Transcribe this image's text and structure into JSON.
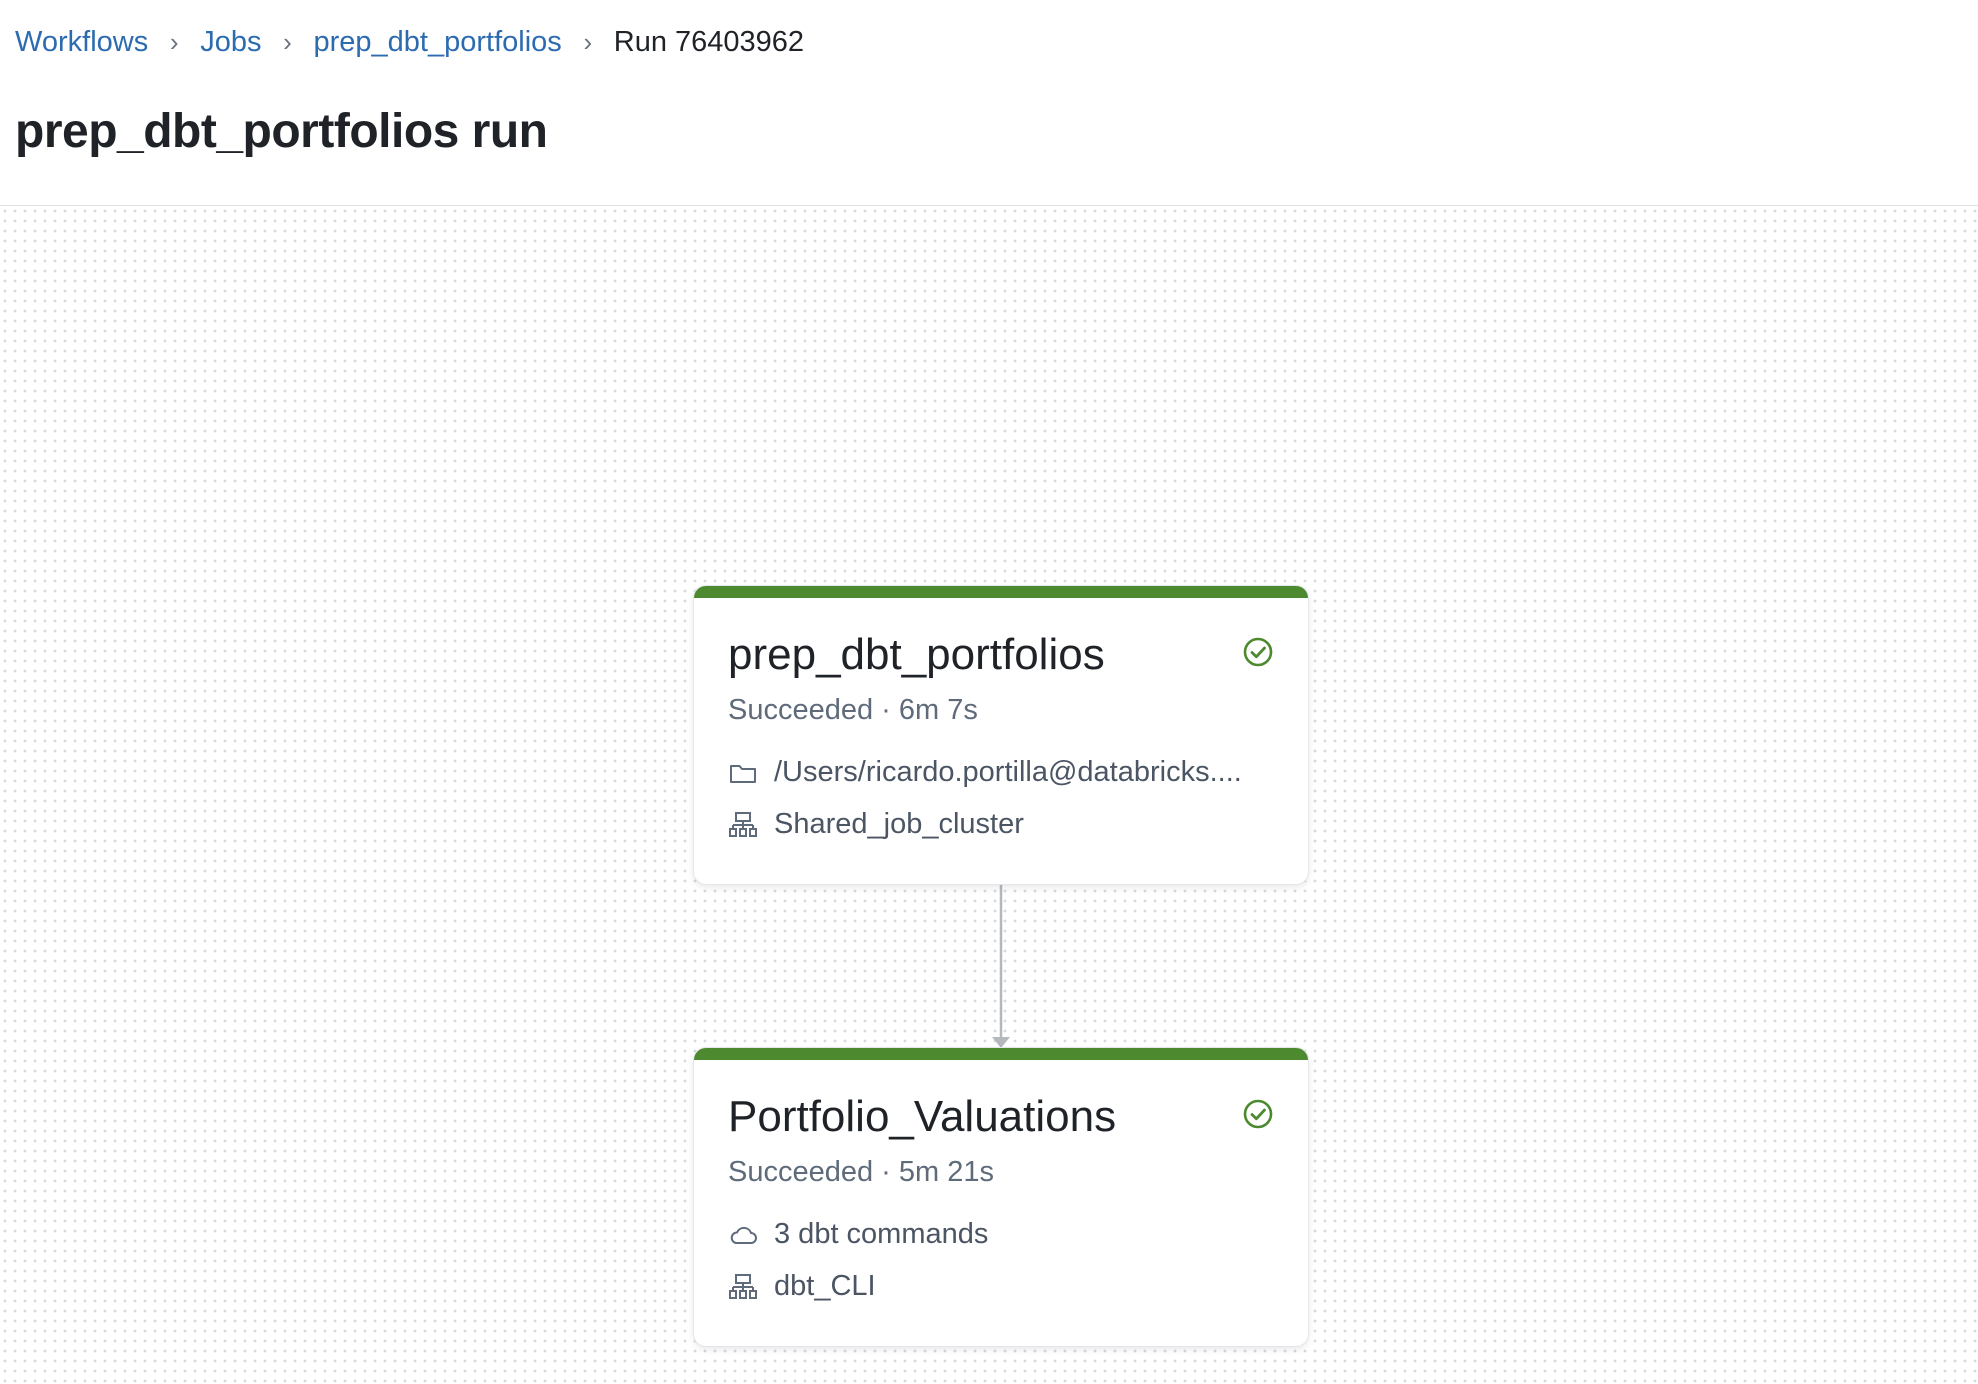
{
  "breadcrumb": {
    "items": [
      "Workflows",
      "Jobs",
      "prep_dbt_portfolios"
    ],
    "current": "Run 76403962"
  },
  "page": {
    "title": "prep_dbt_portfolios run"
  },
  "colors": {
    "success": "#4d8a2f",
    "link": "#2d6bb1"
  },
  "tasks": [
    {
      "name": "prep_dbt_portfolios",
      "status": "Succeeded · 6m 7s",
      "source_icon": "folder-icon",
      "source": "/Users/ricardo.portilla@databricks....",
      "cluster_icon": "cluster-icon",
      "cluster": "Shared_job_cluster"
    },
    {
      "name": "Portfolio_Valuations",
      "status": "Succeeded · 5m 21s",
      "source_icon": "cloud-icon",
      "source": "3 dbt commands",
      "cluster_icon": "cluster-icon",
      "cluster": "dbt_CLI"
    }
  ]
}
